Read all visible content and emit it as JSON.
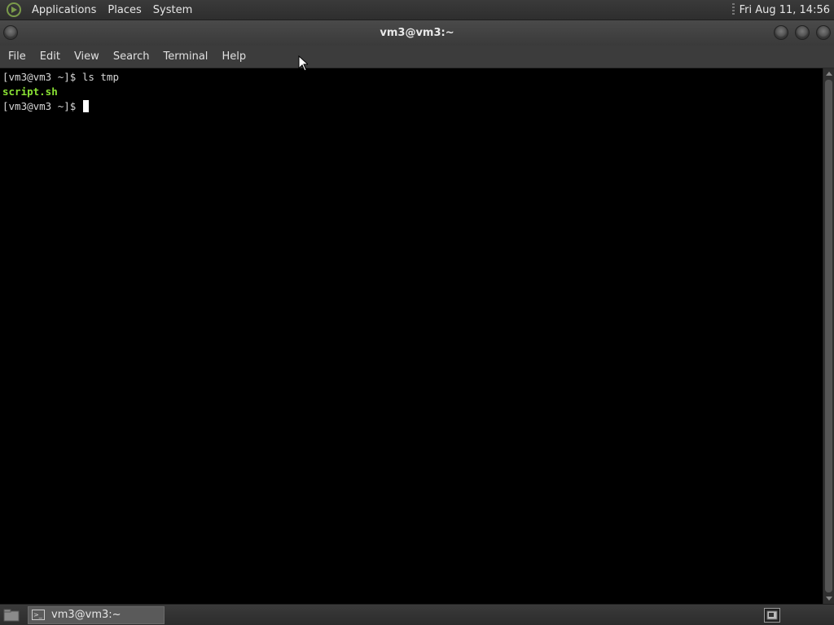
{
  "top_panel": {
    "menus": [
      "Applications",
      "Places",
      "System"
    ],
    "clock": "Fri Aug 11, 14:56"
  },
  "window": {
    "title": "vm3@vm3:~"
  },
  "menubar": {
    "items": [
      "File",
      "Edit",
      "View",
      "Search",
      "Terminal",
      "Help"
    ]
  },
  "terminal": {
    "line1": "[vm3@vm3 ~]$ ls tmp",
    "line2": "script.sh",
    "line3": "[vm3@vm3 ~]$ "
  },
  "taskbar": {
    "task_label": "vm3@vm3:~"
  },
  "icons": {
    "logo": "distro-logo-icon",
    "terminal": "terminal-icon",
    "desktop": "show-desktop-icon"
  },
  "colors": {
    "terminal_bg": "#000000",
    "terminal_fg": "#d6d6d6",
    "exec_file": "#8ae234"
  }
}
